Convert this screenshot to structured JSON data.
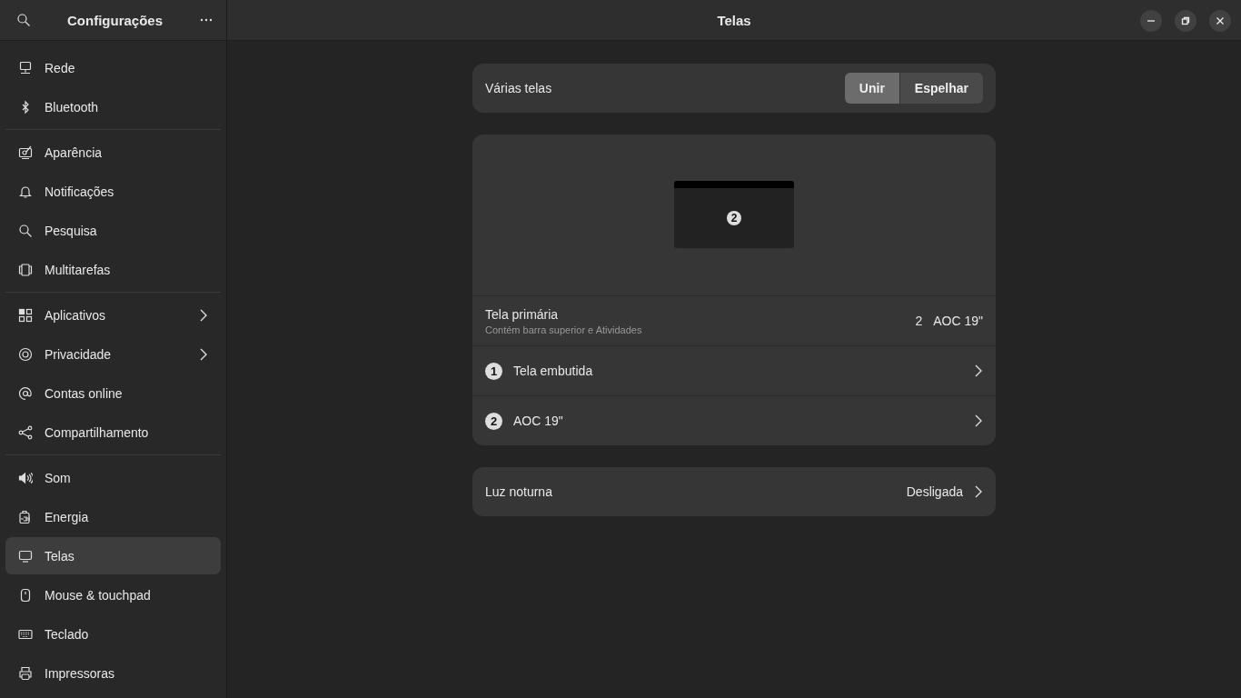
{
  "sidebar": {
    "title": "Configurações",
    "groups": [
      [
        {
          "label": "Rede",
          "arrow": false,
          "selected": false
        },
        {
          "label": "Bluetooth",
          "arrow": false,
          "selected": false
        }
      ],
      [
        {
          "label": "Aparência",
          "arrow": false,
          "selected": false
        },
        {
          "label": "Notificações",
          "arrow": false,
          "selected": false
        },
        {
          "label": "Pesquisa",
          "arrow": false,
          "selected": false
        },
        {
          "label": "Multitarefas",
          "arrow": false,
          "selected": false
        }
      ],
      [
        {
          "label": "Aplicativos",
          "arrow": true,
          "selected": false
        },
        {
          "label": "Privacidade",
          "arrow": true,
          "selected": false
        },
        {
          "label": "Contas online",
          "arrow": false,
          "selected": false
        },
        {
          "label": "Compartilhamento",
          "arrow": false,
          "selected": false
        }
      ],
      [
        {
          "label": "Som",
          "arrow": false,
          "selected": false
        },
        {
          "label": "Energia",
          "arrow": false,
          "selected": false
        },
        {
          "label": "Telas",
          "arrow": false,
          "selected": true
        },
        {
          "label": "Mouse & touchpad",
          "arrow": false,
          "selected": false
        },
        {
          "label": "Teclado",
          "arrow": false,
          "selected": false
        },
        {
          "label": "Impressoras",
          "arrow": false,
          "selected": false
        }
      ]
    ]
  },
  "window": {
    "title": "Telas"
  },
  "multiple_displays": {
    "label": "Várias telas",
    "options": [
      {
        "label": "Unir",
        "selected": true
      },
      {
        "label": "Espelhar",
        "selected": false
      }
    ]
  },
  "arrangement": {
    "monitors": [
      {
        "number": "2"
      }
    ]
  },
  "primary_display": {
    "title": "Tela primária",
    "subtitle": "Contém barra superior e Atividades",
    "number": "2",
    "value": "AOC 19\""
  },
  "displays": [
    {
      "number": "1",
      "name": "Tela embutida"
    },
    {
      "number": "2",
      "name": "AOC 19\""
    }
  ],
  "night_light": {
    "label": "Luz noturna",
    "value": "Desligada"
  }
}
